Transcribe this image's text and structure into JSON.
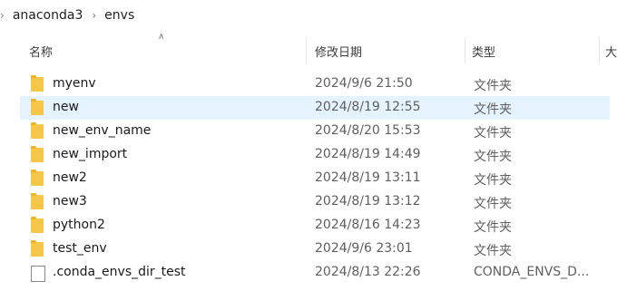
{
  "breadcrumb": {
    "parts": [
      "anaconda3",
      "envs"
    ]
  },
  "header": {
    "name": "名称",
    "date": "修改日期",
    "type": "类型",
    "extra": "大"
  },
  "rows": [
    {
      "name": "myenv",
      "date": "2024/9/6 21:50",
      "type": "文件夹",
      "icon": "folder-icon"
    },
    {
      "name": "new",
      "date": "2024/8/19 12:55",
      "type": "文件夹",
      "icon": "folder-icon",
      "selected": true
    },
    {
      "name": "new_env_name",
      "date": "2024/8/20 15:53",
      "type": "文件夹",
      "icon": "folder-icon"
    },
    {
      "name": "new_import",
      "date": "2024/8/19 14:49",
      "type": "文件夹",
      "icon": "folder-icon"
    },
    {
      "name": "new2",
      "date": "2024/8/19 13:11",
      "type": "文件夹",
      "icon": "folder-icon"
    },
    {
      "name": "new3",
      "date": "2024/8/19 13:12",
      "type": "文件夹",
      "icon": "folder-icon"
    },
    {
      "name": "python2",
      "date": "2024/8/16 14:23",
      "type": "文件夹",
      "icon": "folder-icon"
    },
    {
      "name": "test_env",
      "date": "2024/9/6 23:01",
      "type": "文件夹",
      "icon": "folder-icon"
    },
    {
      "name": ".conda_envs_dir_test",
      "date": "2024/8/13 22:26",
      "type": "CONDA_ENVS_D...",
      "icon": "file-icon"
    }
  ]
}
